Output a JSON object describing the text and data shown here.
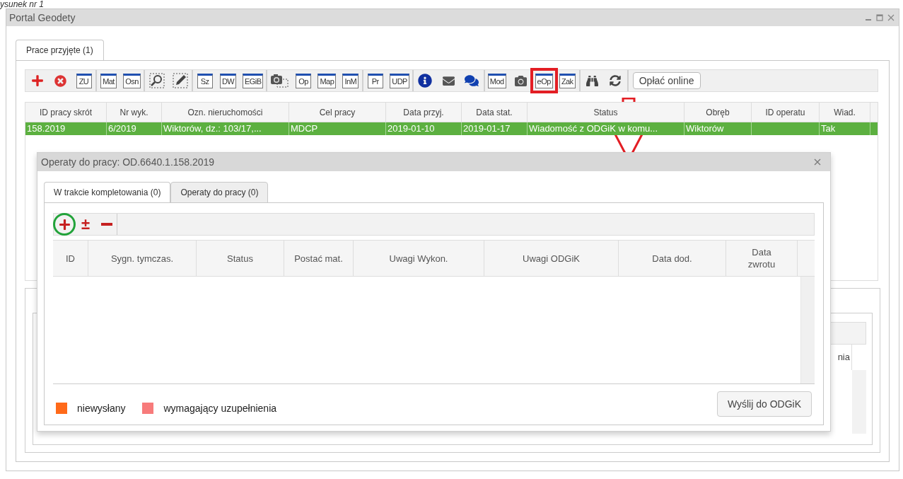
{
  "caption": "ysunek nr 1",
  "window": {
    "title": "Portal Geodety"
  },
  "tabs": [
    {
      "label": "Prace przyjęte (1)",
      "selected": true
    }
  ],
  "toolbar": [
    [
      {
        "kind": "add"
      },
      {
        "kind": "delete"
      },
      {
        "kind": "doc",
        "label": "ZU"
      }
    ],
    [
      {
        "kind": "doc",
        "label": "Mat"
      },
      {
        "kind": "doc",
        "label": "Osn"
      }
    ],
    [
      {
        "kind": "zoom-select"
      },
      {
        "kind": "edit-select"
      }
    ],
    [
      {
        "kind": "doc",
        "label": "Sz"
      },
      {
        "kind": "doc",
        "label": "DW"
      },
      {
        "kind": "doc",
        "label": "EGiB"
      }
    ],
    [
      {
        "kind": "camera-select"
      },
      {
        "kind": "doc",
        "label": "Op"
      },
      {
        "kind": "doc",
        "label": "Map"
      },
      {
        "kind": "doc",
        "label": "InM"
      }
    ],
    [
      {
        "kind": "doc",
        "label": "Pr"
      },
      {
        "kind": "doc",
        "label": "UDP"
      }
    ],
    [
      {
        "kind": "info"
      },
      {
        "kind": "mail"
      },
      {
        "kind": "chat"
      }
    ],
    [
      {
        "kind": "doc",
        "label": "Mod"
      },
      {
        "kind": "camera"
      },
      {
        "kind": "doc",
        "label": "eOp",
        "marked": true
      },
      {
        "kind": "doc",
        "label": "Zak"
      }
    ],
    [
      {
        "kind": "binoculars"
      },
      {
        "kind": "refresh"
      }
    ]
  ],
  "pay_button": "Opłać online",
  "table": {
    "columns": [
      "ID pracy skrót",
      "Nr wyk.",
      "Ozn. nieruchomości",
      "Cel pracy",
      "Data przyj.",
      "Data stat.",
      "Status",
      "Obręb",
      "ID operatu",
      "Wiad."
    ],
    "rows": [
      {
        "selected": true,
        "cells": [
          "158.2019",
          "6/2019",
          "Wiktorów, dz.: 103/17,...",
          "MDCP",
          "2019-01-10",
          "2019-01-17",
          "Wiadomość z ODGiK w komu...",
          "Wiktorów",
          "",
          "Tak"
        ]
      }
    ]
  },
  "lower_table": {
    "column_1": "nia"
  },
  "dialog": {
    "title": "Operaty do pracy: OD.6640.1.158.2019",
    "tabs": [
      {
        "label": "W trakcie kompletowania (0)",
        "selected": true
      },
      {
        "label": "Operaty do pracy (0)",
        "selected": false
      }
    ],
    "toolbar": [
      {
        "kind": "add",
        "marked": true
      },
      {
        "kind": "plus-minus",
        "label": "±"
      },
      {
        "kind": "remove"
      }
    ],
    "columns": [
      "ID",
      "Sygn. tymczas.",
      "Status",
      "Postać mat.",
      "Uwagi Wykon.",
      "Uwagi ODGiK",
      "Data dod.",
      "Data zwrotu"
    ],
    "legend": [
      {
        "label": "niewysłany",
        "color": "#ff6a1a"
      },
      {
        "label": "wymagający uzupełnienia",
        "color": "#f77b7b"
      }
    ],
    "send_button": "Wyślij do ODGiK"
  }
}
